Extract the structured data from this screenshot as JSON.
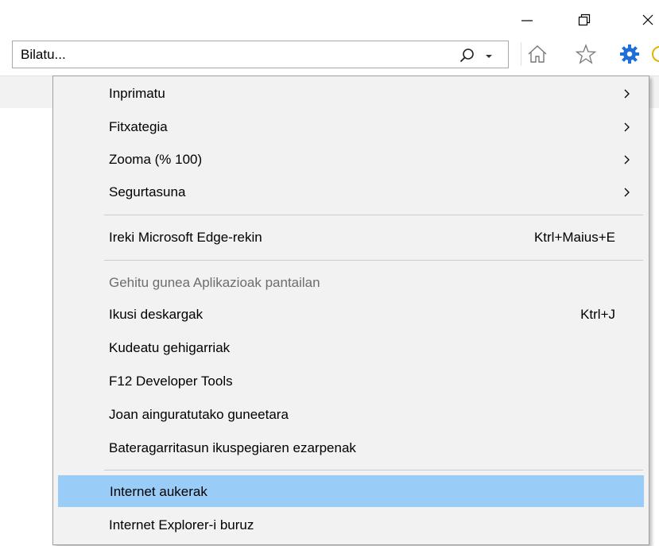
{
  "window": {
    "minimize_icon": "minimize-icon",
    "maximize_icon": "restore-icon",
    "close_icon": "close-icon"
  },
  "search": {
    "value": "Bilatu...",
    "icon": "search-icon",
    "dropdown_icon": "chevron-down-icon"
  },
  "toolbar": {
    "icons": [
      "home-icon",
      "favorites-star-icon",
      "gear-icon",
      "feedback-smiley-icon"
    ],
    "gear_color": "#1e6fd9"
  },
  "menu": {
    "highlight_color": "#99ccf7",
    "items": [
      {
        "label": "Inprimatu",
        "shortcut": "",
        "submenu": true,
        "disabled": false
      },
      {
        "label": "Fitxategia",
        "shortcut": "",
        "submenu": true,
        "disabled": false
      },
      {
        "label": "Zooma (% 100)",
        "shortcut": "",
        "submenu": true,
        "disabled": false
      },
      {
        "label": "Segurtasuna",
        "shortcut": "",
        "submenu": true,
        "disabled": false
      },
      {
        "label": "Ireki Microsoft Edge-rekin",
        "shortcut": "Ktrl+Maius+E",
        "submenu": false,
        "disabled": false
      },
      {
        "label": "Gehitu gunea Aplikazioak pantailan",
        "shortcut": "",
        "submenu": false,
        "disabled": true
      },
      {
        "label": "Ikusi deskargak",
        "shortcut": "Ktrl+J",
        "submenu": false,
        "disabled": false
      },
      {
        "label": "Kudeatu gehigarriak",
        "shortcut": "",
        "submenu": false,
        "disabled": false
      },
      {
        "label": "F12 Developer Tools",
        "shortcut": "",
        "submenu": false,
        "disabled": false
      },
      {
        "label": "Joan ainguratutako guneetara",
        "shortcut": "",
        "submenu": false,
        "disabled": false
      },
      {
        "label": "Bateragarritasun ikuspegiaren ezarpenak",
        "shortcut": "",
        "submenu": false,
        "disabled": false
      },
      {
        "label": "Internet aukerak",
        "shortcut": "",
        "submenu": false,
        "disabled": false,
        "highlighted": true
      },
      {
        "label": "Internet Explorer-i buruz",
        "shortcut": "",
        "submenu": false,
        "disabled": false
      }
    ]
  }
}
